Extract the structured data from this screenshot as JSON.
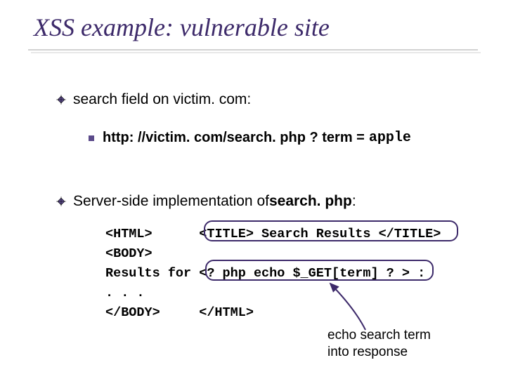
{
  "title": "XSS example: vulnerable site",
  "bullet1": "search field on victim. com:",
  "sub1_prefix": "http: //victim. com/search. php ? term = ",
  "sub1_term": "apple",
  "bullet2_pre": "Server-side implementation of  ",
  "bullet2_code": "search. php",
  "bullet2_post": ":",
  "code": {
    "l1a": "<HTML>      ",
    "l1b": "<TITLE> Search Results </TITLE>",
    "l2": "<BODY>",
    "l3a": "Results for ",
    "l3b": "<? php echo $_GET[term] ? >",
    "l3c": " :",
    "l4": ". . .",
    "l5": "</BODY>     </HTML>"
  },
  "annotation_l1": "echo search term",
  "annotation_l2": "into response"
}
